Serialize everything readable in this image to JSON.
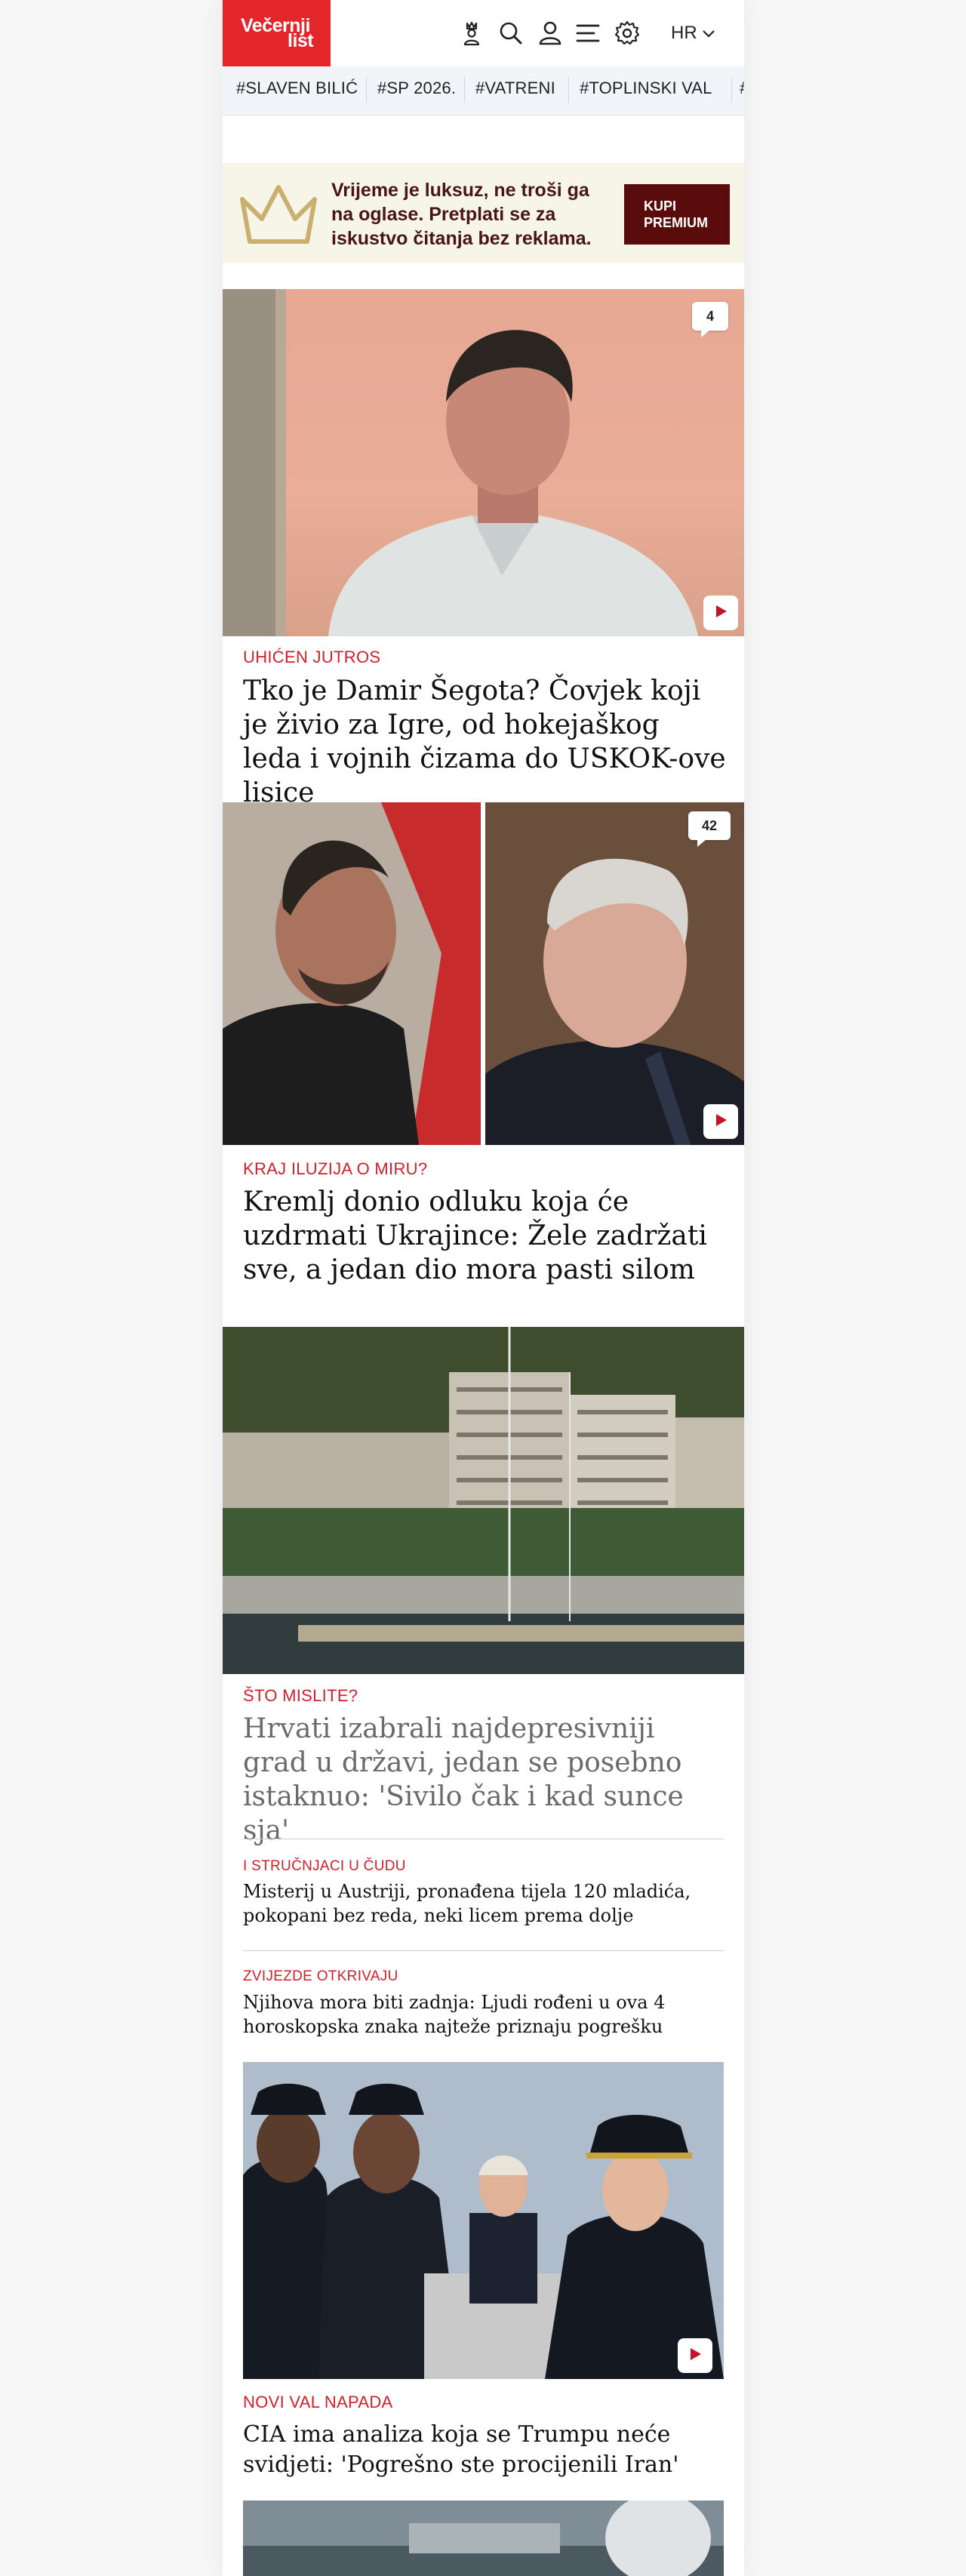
{
  "header": {
    "logo_line1": "Večernji",
    "logo_line2": "list",
    "language": "HR",
    "icons": [
      "crown-user-icon",
      "search-icon",
      "user-icon",
      "menu-icon",
      "settings-icon",
      "chevron-down-icon"
    ]
  },
  "tags": [
    "#SLAVEN BILIĆ",
    "#SP 2026.",
    "#VATRENI",
    "#TOPLINSKI VAL",
    "#"
  ],
  "promo": {
    "text": "Vrijeme je luksuz, ne troši ga na oglase. Pretplati se za iskustvo čitanja bez reklama.",
    "button_line1": "KUPI",
    "button_line2": "PREMIUM"
  },
  "articles": [
    {
      "kicker": "UHIĆEN JUTROS",
      "title": "Tko je Damir Šegota? Čovjek koji je živio za Igre, od hokejaškog leda i vojnih čizama do USKOK-ove lisice",
      "comments": "4",
      "has_video": true
    },
    {
      "kicker": "KRAJ ILUZIJA O MIRU?",
      "title": "Kremlj donio odluku koja će uzdrmati Ukrajince: Žele zadržati sve, a jedan dio mora pasti silom",
      "comments": "42",
      "has_video": true
    },
    {
      "kicker": "ŠTO MISLITE?",
      "title": "Hrvati izabrali najdepresivniji grad u državi, jedan se posebno istaknuo: 'Sivilo čak i kad sunce sja'"
    },
    {
      "kicker": "I STRUČNJACI U ČUDU",
      "title": "Misterij u Austriji, pronađena tijela 120 mladića, pokopani bez reda, neki licem prema dolje"
    },
    {
      "kicker": "ZVIJEZDE OTKRIVAJU",
      "title": "Njihova mora biti zadnja: Ljudi rođeni u ova 4 horoskopska znaka najteže priznaju pogrešku"
    },
    {
      "kicker": "NOVI VAL NAPADA",
      "title": "CIA ima analiza koja se Trumpu neće svidjeti: 'Pogrešno ste procijenili Iran'",
      "has_video": true
    }
  ],
  "colors": {
    "brand_red": "#e3262c",
    "kicker_red": "#d0202a",
    "promo_bg": "#f7f5e8",
    "promo_button": "#5a0b0b"
  }
}
